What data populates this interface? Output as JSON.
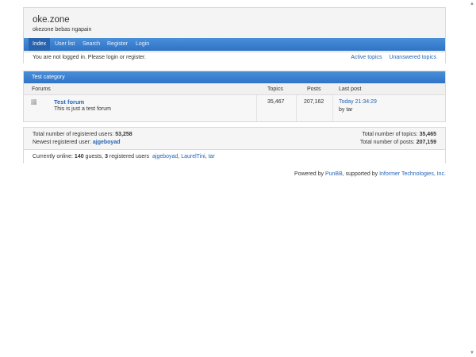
{
  "site": {
    "title": "oke.zone",
    "description": "okezone bebas ngapain"
  },
  "nav": [
    {
      "label": "Index",
      "active": true
    },
    {
      "label": "User list"
    },
    {
      "label": "Search"
    },
    {
      "label": "Register"
    },
    {
      "label": "Login"
    }
  ],
  "status": {
    "message": "You are not logged in. Please login or register.",
    "links": [
      "Active topics",
      "Unanswered topics"
    ]
  },
  "category": {
    "name": "Test category",
    "columns": [
      "Forums",
      "Topics",
      "Posts",
      "Last post"
    ],
    "forum": {
      "title": "Test forum",
      "desc": "This is just a test forum",
      "topics": "35,467",
      "posts": "207,162",
      "last_post_time": "Today 21:34:29",
      "last_post_by": "by tar"
    }
  },
  "stats": {
    "registered_label": "Total number of registered users: ",
    "registered_value": "53,258",
    "newest_label": "Newest registered user: ",
    "newest_value": "ajgeboyad",
    "topics_label": "Total number of topics: ",
    "topics_value": "35,465",
    "posts_label": "Total number of posts: ",
    "posts_value": "207,159",
    "online_prefix": "Currently online: ",
    "online_guests": "140",
    "online_mid": " guests, ",
    "online_registered": "3",
    "online_suffix": " registered users",
    "online_users": [
      "ajgeboyad",
      "LaurelTini",
      "tar"
    ]
  },
  "footer": {
    "prefix": "Powered by ",
    "punbb": "PunBB",
    "mid": ", supported by ",
    "informer": "Informer Technologies, Inc."
  }
}
